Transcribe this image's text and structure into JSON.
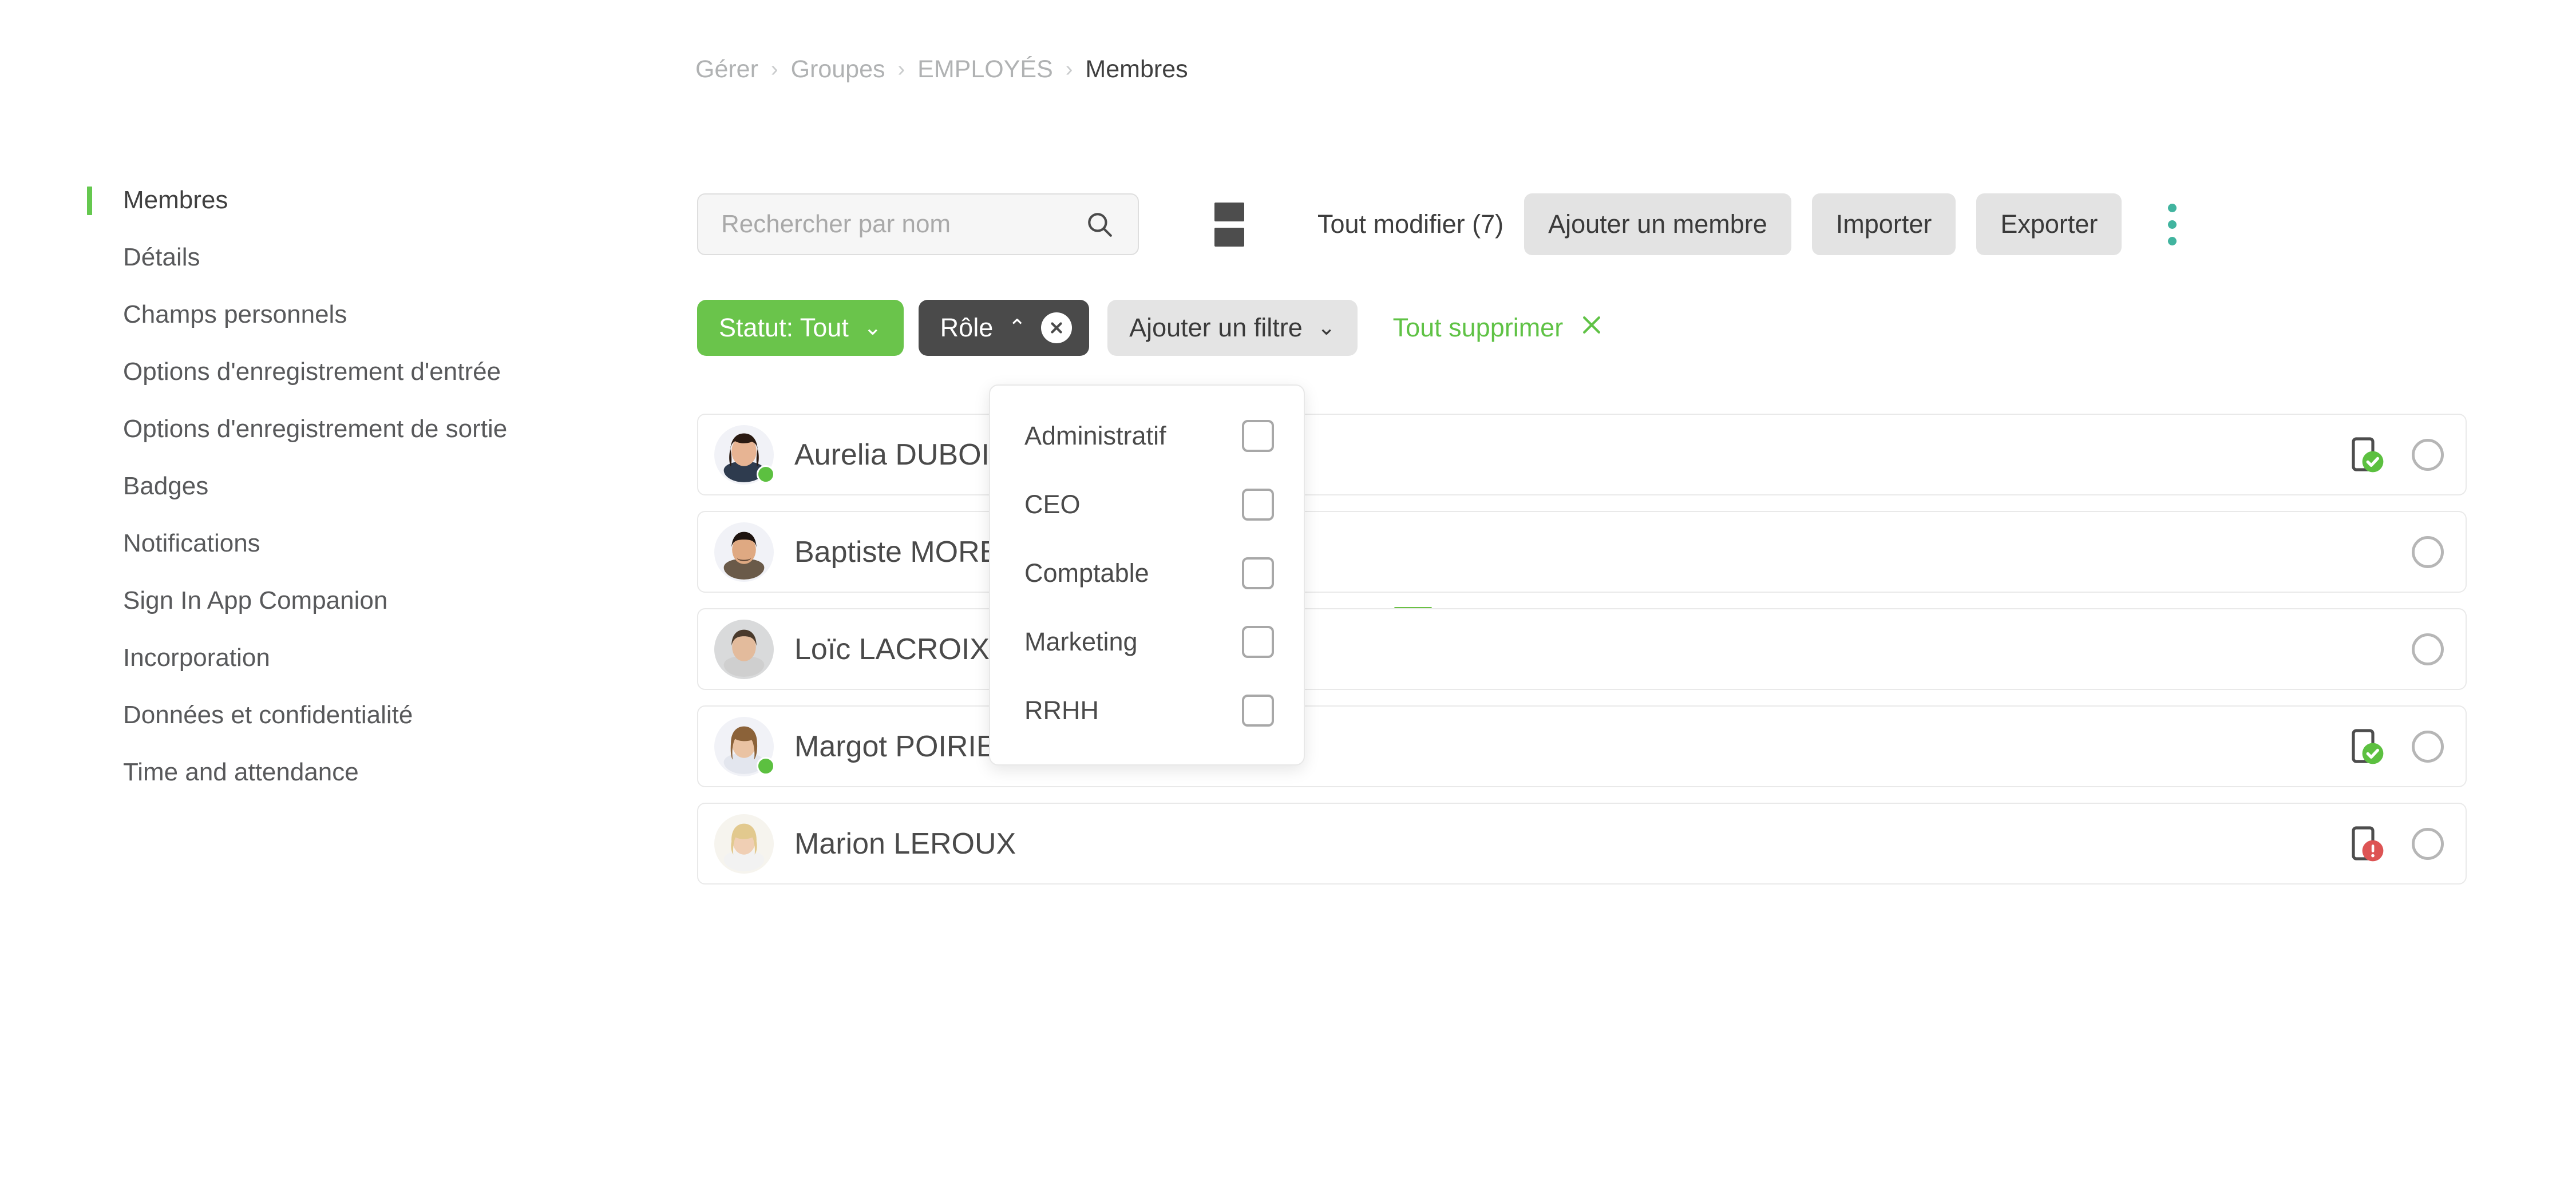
{
  "breadcrumb": {
    "items": [
      {
        "label": "Gérer",
        "active": false
      },
      {
        "label": "Groupes",
        "active": false
      },
      {
        "label": "EMPLOYÉS",
        "active": false
      },
      {
        "label": "Membres",
        "active": true
      }
    ],
    "separator": "›"
  },
  "sidebar": {
    "items": [
      {
        "label": "Membres",
        "active": true
      },
      {
        "label": "Détails",
        "active": false
      },
      {
        "label": "Champs personnels",
        "active": false
      },
      {
        "label": "Options d'enregistrement d'entrée",
        "active": false
      },
      {
        "label": "Options d'enregistrement de sortie",
        "active": false
      },
      {
        "label": "Badges",
        "active": false
      },
      {
        "label": "Notifications",
        "active": false
      },
      {
        "label": "Sign In App Companion",
        "active": false
      },
      {
        "label": "Incorporation",
        "active": false
      },
      {
        "label": "Données et confidentialité",
        "active": false
      },
      {
        "label": "Time and attendance",
        "active": false
      }
    ]
  },
  "toolbar": {
    "search": {
      "placeholder": "Rechercher par nom",
      "value": ""
    },
    "search_icon": "search-icon",
    "view_list_icon": "list-view-icon",
    "view_cards_icon": "card-view-icon",
    "edit_all_label": "Tout modifier (7)",
    "add_member_label": "Ajouter un membre",
    "import_label": "Importer",
    "export_label": "Exporter",
    "overflow_icon": "more-vertical-icon"
  },
  "filters": {
    "status": {
      "label": "Statut: Tout",
      "chevron": "⌄",
      "state": "active"
    },
    "role": {
      "label": "Rôle",
      "chevron": "⌃",
      "state": "open"
    },
    "add_filter": {
      "label": "Ajouter un filtre",
      "chevron": "⌄"
    },
    "clear_all": {
      "label": "Tout supprimer",
      "icon": "close-icon"
    }
  },
  "role_dropdown": {
    "open": true,
    "options": [
      {
        "label": "Administratif",
        "checked": false
      },
      {
        "label": "CEO",
        "checked": false
      },
      {
        "label": "Comptable",
        "checked": false
      },
      {
        "label": "Marketing",
        "checked": false
      },
      {
        "label": "RRHH",
        "checked": false
      }
    ]
  },
  "members": [
    {
      "name": "Aurelia DUBOIS",
      "online": true,
      "device": "verified",
      "selected": false,
      "avatar_hair": "#2a1a12",
      "avatar_skin": "#e7b493",
      "avatar_bg": "#f1f2f7",
      "avatar_cloth": "#2e3b4e"
    },
    {
      "name": "Baptiste MOREAU",
      "online": false,
      "device": "none",
      "selected": false,
      "avatar_hair": "#1e1410",
      "avatar_skin": "#dfa982",
      "avatar_bg": "#f1f2f7",
      "avatar_cloth": "#6a5a49"
    },
    {
      "name": "Loïc LACROIX",
      "online": false,
      "device": "none",
      "selected": false,
      "avatar_hair": "#4a3a2c",
      "avatar_skin": "#e3bb9c",
      "avatar_bg": "#d9dadb",
      "avatar_cloth": "#cfcfcf"
    },
    {
      "name": "Margot POIRIER",
      "online": true,
      "device": "verified",
      "selected": false,
      "avatar_hair": "#8b6239",
      "avatar_skin": "#eac3a3",
      "avatar_bg": "#f1f2f7",
      "avatar_cloth": "#e3e6ee"
    },
    {
      "name": "Marion LEROUX",
      "online": false,
      "device": "warning",
      "selected": false,
      "avatar_hair": "#e2c98e",
      "avatar_skin": "#f0cfb4",
      "avatar_bg": "#f6f4ee",
      "avatar_cloth": "#f2f2f2"
    }
  ],
  "colors": {
    "brand_green": "#6ac44b",
    "accent_teal": "#41b49f",
    "dark_pill": "#4a4a4a",
    "grey_button": "#e3e3e3",
    "status_online": "#5cc040",
    "status_error": "#dd5454",
    "text_primary": "#4a4a4a",
    "text_muted": "#b0b2b3"
  }
}
